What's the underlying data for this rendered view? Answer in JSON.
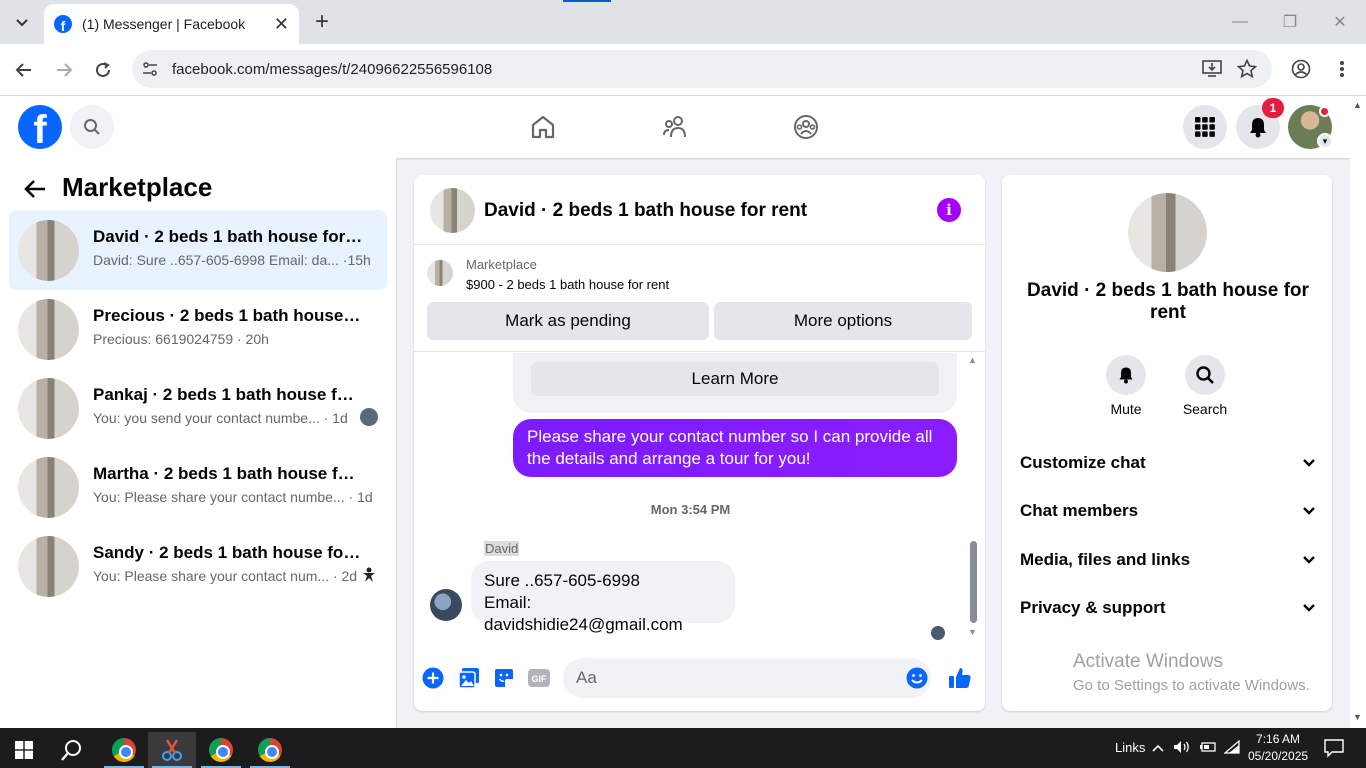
{
  "browser": {
    "tab_title": "(1) Messenger | Facebook",
    "url": "facebook.com/messages/t/24096622556596108"
  },
  "fb_header": {
    "notification_count": "1"
  },
  "left_panel": {
    "title": "Marketplace",
    "conversations": [
      {
        "name": "David · 2 beds 1 bath house for rent",
        "snippet": "David: Sure ..657-605-6998 Email: da... ·15h",
        "active": true
      },
      {
        "name": "Precious · 2 beds 1 bath house for ...",
        "snippet": "Precious: 6619024759 · 20h"
      },
      {
        "name": "Pankaj · 2 beds 1 bath house for ...",
        "snippet": "You: you send your contact numbe... · 1d"
      },
      {
        "name": "Martha · 2 beds 1 bath house for r...",
        "snippet": "You: Please share your contact numbe... · 1d"
      },
      {
        "name": "Sandy · 2 beds 1 bath house for ...",
        "snippet": "You: Please share your contact num... · 2d"
      }
    ]
  },
  "chat": {
    "title": "David · 2 beds 1 bath house for rent",
    "listing_label": "Marketplace",
    "listing_price": "$900 - 2 beds 1 bath house for rent",
    "mark_pending": "Mark as pending",
    "more_options": "More options",
    "learn_more": "Learn More",
    "outgoing_message": "Please share your contact number so I can provide all the details and arrange a tour for you!",
    "timestamp": "Mon 3:54 PM",
    "sender_name": "David",
    "incoming_line1": "Sure ..657-605-6998",
    "incoming_line2": "Email: davidshidie24@gmail.com",
    "composer_placeholder": "Aa"
  },
  "right_panel": {
    "name": "David · 2 beds 1 bath house for rent",
    "mute_label": "Mute",
    "search_label": "Search",
    "rows": [
      "Customize chat",
      "Chat members",
      "Media, files and links",
      "Privacy & support"
    ]
  },
  "watermark": {
    "line1": "Activate Windows",
    "line2": "Go to Settings to activate Windows."
  },
  "taskbar": {
    "links": "Links",
    "time": "7:16 AM",
    "date": "05/20/2025"
  },
  "colors": {
    "fb_blue": "#0866ff",
    "messenger_purple": "#8b1dff",
    "notification_red": "#e41e3f"
  }
}
